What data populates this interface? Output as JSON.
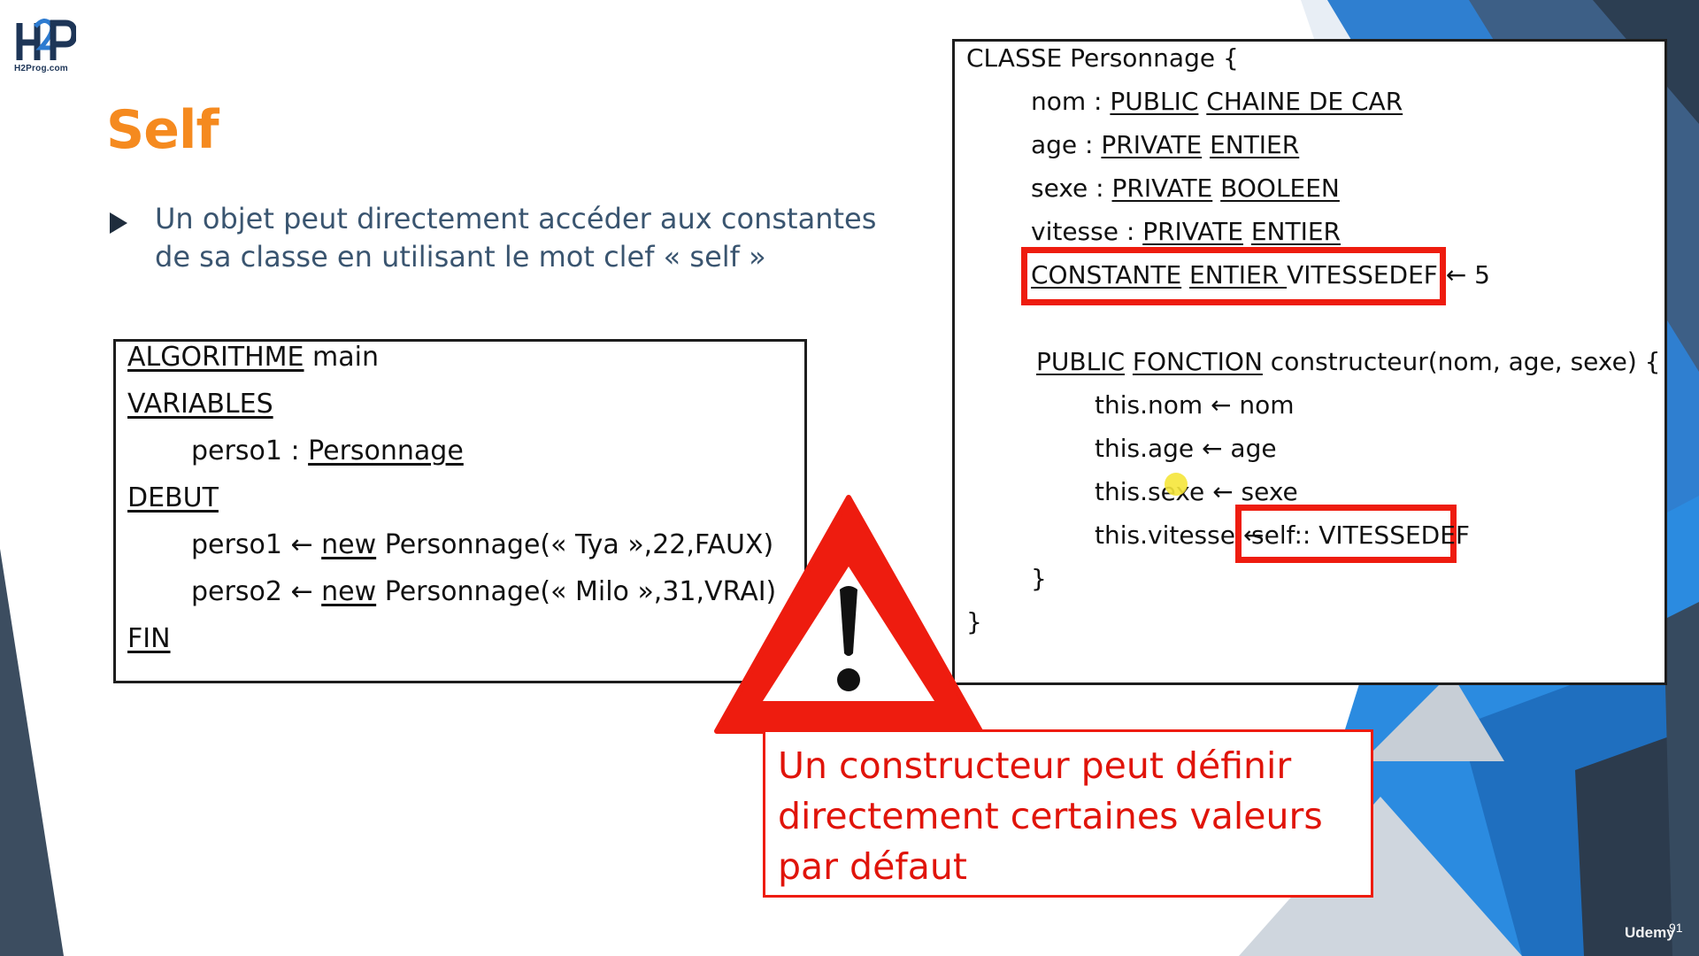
{
  "logo": {
    "letters": "H2P",
    "site": "H2Prog.com"
  },
  "title": "Self",
  "bullet": "Un objet peut directement accéder aux constantes de sa classe en utilisant le mot clef « self »",
  "algo": {
    "l1_kw": "ALGORITHME",
    "l1_rest": " main",
    "l2": "VARIABLES",
    "l3_a": "perso1 : ",
    "l3_b": "Personnage",
    "l4": "DEBUT",
    "l5_a": "perso1 ",
    "l5_arrow": "← ",
    "l5_kw": "new",
    "l5_rest": " Personnage(« Tya »,22,FAUX)",
    "l6_a": "perso2 ",
    "l6_arrow": "← ",
    "l6_kw": "new",
    "l6_rest": " Personnage(« Milo »,31,VRAI)",
    "l7": "FIN"
  },
  "classe": {
    "c1": "CLASSE Personnage {",
    "c2_a": "nom : ",
    "c2_b": "PUBLIC",
    "c2_c": "CHAINE DE CAR",
    "c3_a": "age : ",
    "c3_b": "PRIVATE",
    "c3_c": "ENTIER",
    "c4_a": "sexe : ",
    "c4_b": "PRIVATE",
    "c4_c": "BOOLEEN",
    "c5_a": "vitesse : ",
    "c5_b": "PRIVATE",
    "c5_c": "ENTIER",
    "c6_a": "CONSTANTE",
    "c6_b": "ENTIER ",
    "c6_c": "VITESSEDEF ← 5",
    "c7_a": "PUBLIC",
    "c7_b": "FONCTION",
    "c7_c": " constructeur(nom, age, sexe) {",
    "c8": "this.nom ← nom",
    "c9": "this.age ← age",
    "c10": "this.sexe ← sexe",
    "c11": "this.vitesse ←",
    "c11_self": "self:: VITESSEDEF",
    "c12": "}",
    "c13": "}"
  },
  "warning": {
    "icon": "warning-triangle-icon",
    "message": "Un constructeur peut définir directement certaines valeurs par défaut"
  },
  "footer": {
    "brand": "Udemy",
    "page": "91"
  },
  "colors": {
    "title": "#f58a1f",
    "bullet_text": "#3a5570",
    "highlight": "#ee1c0f",
    "bg_dark": "#2f4256",
    "bg_blue": "#2f7fd0"
  }
}
